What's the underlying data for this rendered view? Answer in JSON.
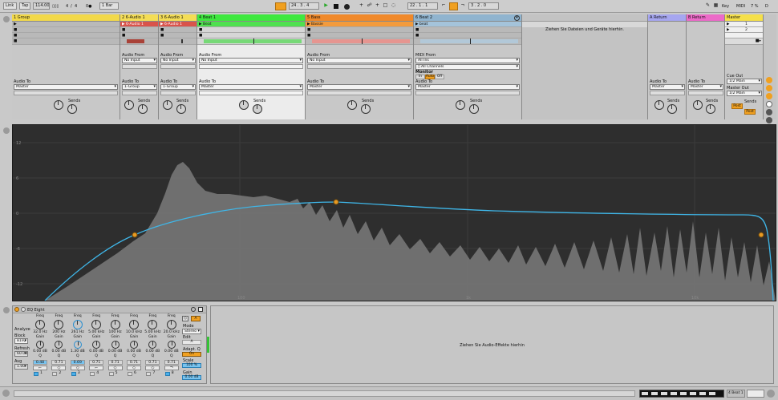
{
  "transport": {
    "link": "Link",
    "tap": "Tap",
    "tempo": "114.00",
    "signature_num": "4",
    "signature_den": "4",
    "metronome": "0●",
    "quantize": "1 Bar",
    "position": "24 .  3 .  4",
    "loop_start": "22 .  1 .  1",
    "loop_length": "3 .  2 .  0",
    "key": "Key",
    "midi": "MIDI",
    "cpu": "7 %",
    "disk": "D"
  },
  "tracks": [
    {
      "name": "1 Group",
      "color": "#f2d94a",
      "clip": "",
      "audio_to_label": "Audio To",
      "audio_to": "Master",
      "sends_label": "Sends"
    },
    {
      "name": "2 6-Audio 1",
      "color": "#f4dd55",
      "clip": "6-Audio 1",
      "clip_color": "#d9534b",
      "audio_from_label": "Audio From",
      "audio_from": "No Input",
      "audio_to_label": "Audio To",
      "audio_to": "1-Group",
      "sends_label": "Sends"
    },
    {
      "name": "3 6-Audio 1",
      "color": "#f4dd55",
      "clip": "6-Audio 1",
      "clip_color": "#d9534b",
      "audio_from_label": "Audio From",
      "audio_from": "No Input",
      "audio_to_label": "Audio To",
      "audio_to": "1-Group",
      "sends_label": "Sends"
    },
    {
      "name": "4 Beat 1",
      "color": "#3ee83e",
      "clip": "Beat",
      "clip_color": "#4fe04f",
      "audio_from_label": "Audio From",
      "audio_from": "No Input",
      "audio_to_label": "Audio To",
      "audio_to": "Master",
      "sends_label": "Sends"
    },
    {
      "name": "5 Bass",
      "color": "#f0892a",
      "clip": "Bassie",
      "clip_color": "#f39b3d",
      "audio_from_label": "Audio From",
      "audio_from": "No Input",
      "audio_to_label": "Audio To",
      "audio_to": "Master",
      "sends_label": "Sends"
    },
    {
      "name": "6 Beat 2",
      "color": "#90b4cf",
      "clip": "beat",
      "clip_color": "#a4c3da",
      "midi_from_label": "MIDI From",
      "midi_from": "All Ins",
      "midi_channel": "All Channels",
      "monitor_label": "Monitor",
      "monitor_options": [
        "In",
        "Auto",
        "Off"
      ],
      "audio_to_label": "Audio To",
      "audio_to": "Master",
      "sends_label": "Sends"
    }
  ],
  "drop_hint_tracks": "Ziehen Sie Dateien und Geräte hierhin.",
  "returns": [
    {
      "name": "A Return",
      "color": "#a6a6f0",
      "audio_to_label": "Audio To",
      "audio_to": "Master",
      "sends_label": "Sends"
    },
    {
      "name": "B Return",
      "color": "#ec6ac8",
      "audio_to_label": "Audio To",
      "audio_to": "Master",
      "sends_label": "Sends"
    }
  ],
  "master": {
    "name": "Master",
    "color": "#f5e04a",
    "scenes": [
      "1",
      "2"
    ],
    "cue_out_label": "Cue Out",
    "cue_out": "1/2 Main",
    "master_out_label": "Master Out",
    "master_out": "1/2 Main",
    "sends_label": "Sends",
    "post_label": "Post"
  },
  "eq_display": {
    "y_labels": [
      "12",
      "6",
      "0",
      "-6",
      "-12"
    ],
    "x_labels": [
      "100",
      "1k",
      "10k"
    ]
  },
  "device": {
    "title": "EQ Eight",
    "analyze_label": "Analyze",
    "block_label": "Block",
    "block_value": "8192",
    "refresh_label": "Refresh",
    "refresh_value": "60.00",
    "avg_label": "Avg",
    "avg_value": "1.00",
    "mode_label": "Mode",
    "mode_value": "Stereo",
    "edit_label": "Edit",
    "edit_value": "A",
    "adapt_label": "Adapt. Q",
    "adapt_value": "On",
    "scale_label": "Scale",
    "scale_value": "100 %",
    "gain_label": "Gain",
    "gain_value": "0.00 dB",
    "bands": [
      {
        "freq": "32.0 Hz",
        "gain": "0.00 dB",
        "q": "0.48",
        "num": "1",
        "active": true,
        "selected": false,
        "shape": "⌐"
      },
      {
        "freq": "200 Hz",
        "gain": "0.00 dB",
        "q": "0.71",
        "num": "2",
        "active": false,
        "selected": false,
        "shape": "◇"
      },
      {
        "freq": "261 Hz",
        "gain": "1.30 dB",
        "q": "0.69",
        "num": "3",
        "active": true,
        "selected": true,
        "shape": "◇"
      },
      {
        "freq": "5.00 kHz",
        "gain": "0.00 dB",
        "q": "0.71",
        "num": "4",
        "active": false,
        "selected": false,
        "shape": "⌐"
      },
      {
        "freq": "100 Hz",
        "gain": "0.00 dB",
        "q": "0.71",
        "num": "5",
        "active": false,
        "selected": false,
        "shape": "◇"
      },
      {
        "freq": "10.0 kHz",
        "gain": "0.00 dB",
        "q": "0.71",
        "num": "6",
        "active": false,
        "selected": false,
        "shape": "◇"
      },
      {
        "freq": "5.00 kHz",
        "gain": "0.00 dB",
        "q": "0.71",
        "num": "7",
        "active": false,
        "selected": false,
        "shape": "◇"
      },
      {
        "freq": "20.0 kHz",
        "gain": "0.00 dB",
        "q": "0.71",
        "num": "8",
        "active": true,
        "selected": false,
        "shape": "¬"
      }
    ],
    "band_freq_label": "Freq",
    "band_gain_label": "Gain",
    "band_q_label": "Q"
  },
  "drop_hint_effects": "Ziehen Sie Audio-Effekte hierhin",
  "bottom": {
    "track_label": "4 Beat 1"
  }
}
